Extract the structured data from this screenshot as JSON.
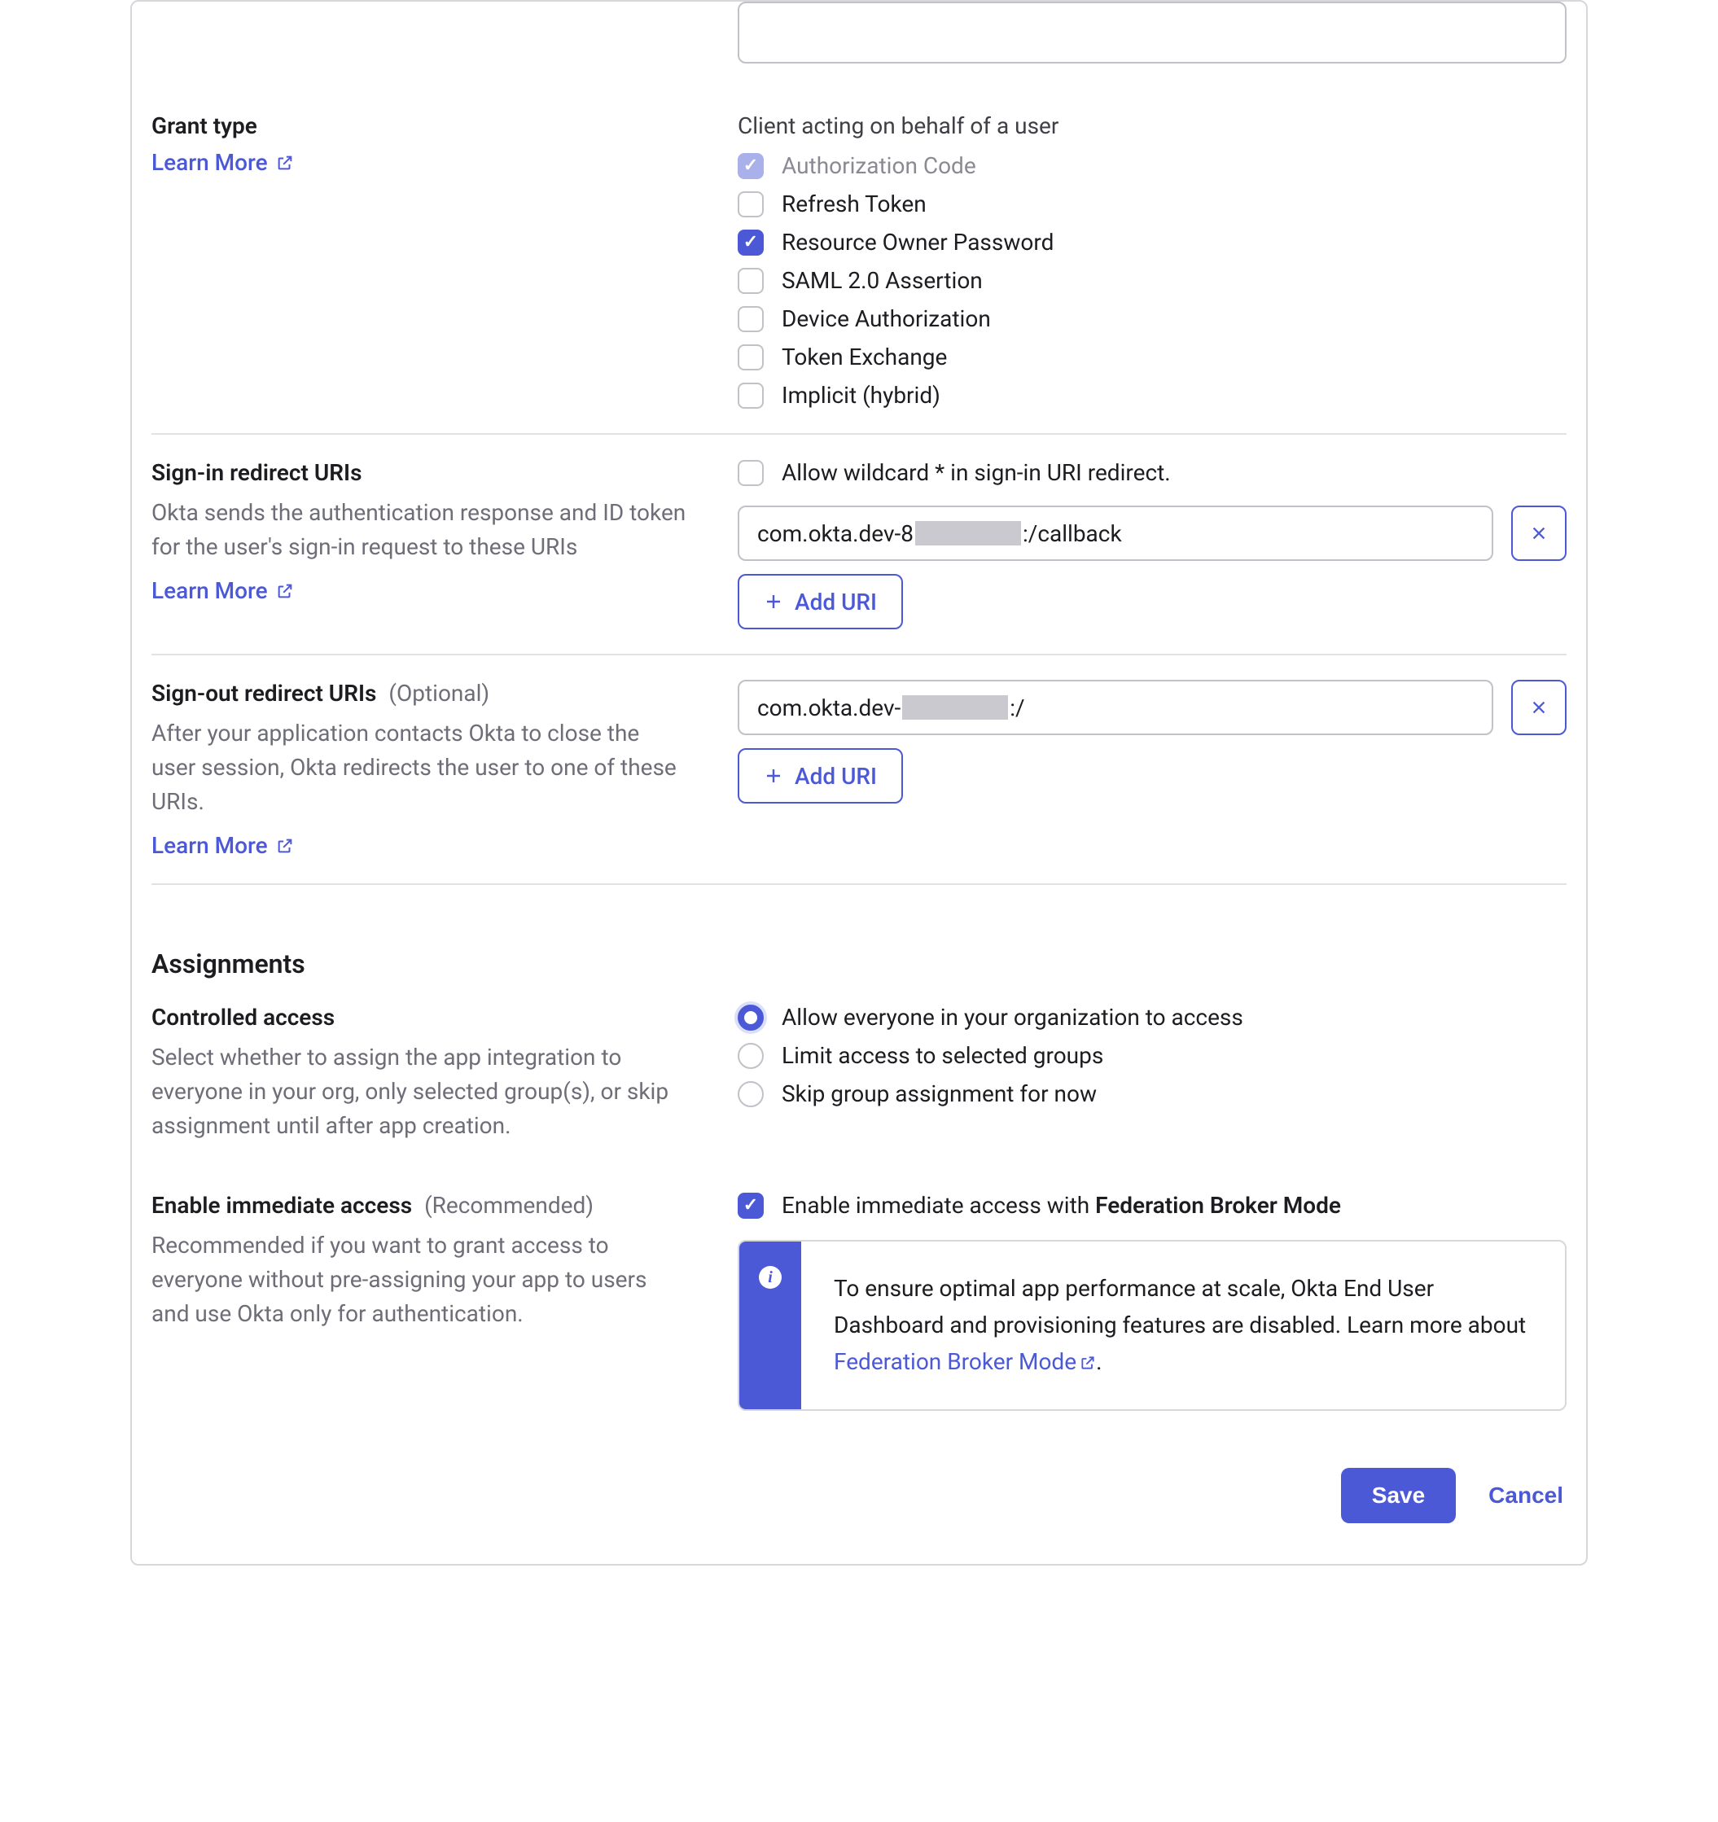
{
  "grant_type": {
    "label": "Grant type",
    "learn_more": "Learn More",
    "subheading": "Client acting on behalf of a user",
    "options": [
      {
        "label": "Authorization Code",
        "checked": true,
        "disabled": true
      },
      {
        "label": "Refresh Token",
        "checked": false,
        "disabled": false
      },
      {
        "label": "Resource Owner Password",
        "checked": true,
        "disabled": false
      },
      {
        "label": "SAML 2.0 Assertion",
        "checked": false,
        "disabled": false
      },
      {
        "label": "Device Authorization",
        "checked": false,
        "disabled": false
      },
      {
        "label": "Token Exchange",
        "checked": false,
        "disabled": false
      },
      {
        "label": "Implicit (hybrid)",
        "checked": false,
        "disabled": false
      }
    ]
  },
  "signin": {
    "label": "Sign-in redirect URIs",
    "desc": "Okta sends the authentication response and ID token for the user's sign-in request to these URIs",
    "learn_more": "Learn More",
    "wildcard_label": "Allow wildcard * in sign-in URI redirect.",
    "uri_prefix": "com.okta.dev-8",
    "uri_suffix": ":/callback",
    "add_uri": "Add URI"
  },
  "signout": {
    "label": "Sign-out redirect URIs",
    "optional": "(Optional)",
    "desc": "After your application contacts Okta to close the user session, Okta redirects the user to one of these URIs.",
    "learn_more": "Learn More",
    "uri_prefix": "com.okta.dev-",
    "uri_suffix": ":/",
    "add_uri": "Add URI"
  },
  "assignments": {
    "heading": "Assignments"
  },
  "access": {
    "label": "Controlled access",
    "desc": "Select whether to assign the app integration to everyone in your org, only selected group(s), or skip assignment until after app creation.",
    "options": [
      {
        "label": "Allow everyone in your organization to access",
        "selected": true
      },
      {
        "label": "Limit access to selected groups",
        "selected": false
      },
      {
        "label": "Skip group assignment for now",
        "selected": false
      }
    ]
  },
  "immediate": {
    "label": "Enable immediate access",
    "recommended": "(Recommended)",
    "desc": "Recommended if you want to grant access to everyone without pre-assigning your app to users and use Okta only for authentication.",
    "check_prefix": "Enable immediate access with ",
    "check_bold": "Federation Broker Mode",
    "info_text": "To ensure optimal app performance at scale, Okta End User Dashboard and provisioning features are disabled. Learn more about ",
    "info_link": "Federation Broker Mode",
    "info_period": "."
  },
  "buttons": {
    "save": "Save",
    "cancel": "Cancel"
  }
}
